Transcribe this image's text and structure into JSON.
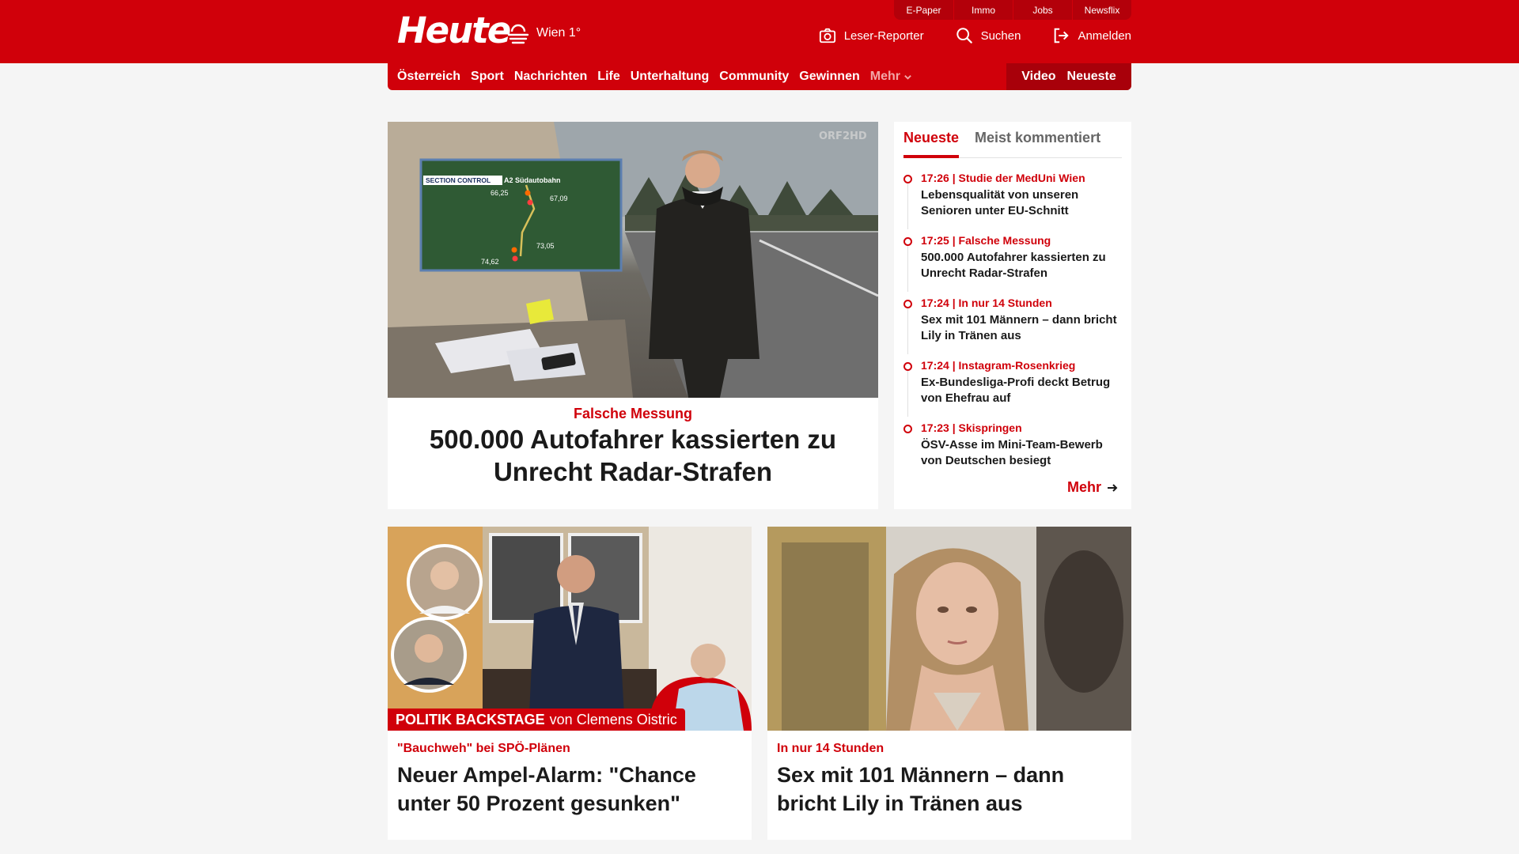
{
  "brand": {
    "logo": "Heute",
    "weather": "Wien 1°"
  },
  "service_tabs": [
    "E-Paper",
    "Immo",
    "Jobs",
    "Newsflix"
  ],
  "header_actions": {
    "reporter": "Leser-Reporter",
    "search": "Suchen",
    "login": "Anmelden"
  },
  "nav": {
    "items": [
      "Österreich",
      "Sport",
      "Nachrichten",
      "Life",
      "Unterhaltung",
      "Community",
      "Gewinnen"
    ],
    "more": "Mehr",
    "right": [
      "Video",
      "Neueste"
    ]
  },
  "hero": {
    "kicker": "Falsche Messung",
    "title": "500.000 Autofahrer kassierten zu Unrecht Radar-Strafen",
    "overlay": {
      "watermark": "ORF2HD",
      "section_label": "SECTION CONTROL",
      "road": "A2 Südautobahn",
      "km1": "66,25",
      "km2": "67,09",
      "km3": "73,05",
      "km4": "74,62"
    }
  },
  "sidebar": {
    "tabs": [
      "Neueste",
      "Meist kommentiert"
    ],
    "items": [
      {
        "time": "17:26",
        "topic": "Studie der MedUni Wien",
        "headline": "Lebensqualität von unseren Senioren unter EU-Schnitt"
      },
      {
        "time": "17:25",
        "topic": "Falsche Messung",
        "headline": "500.000 Autofahrer kassierten zu Unrecht Radar-Strafen"
      },
      {
        "time": "17:24",
        "topic": "In nur 14 Stunden",
        "headline": "Sex mit 101 Männern – dann bricht Lily in Tränen aus"
      },
      {
        "time": "17:24",
        "topic": "Instagram-Rosenkrieg",
        "headline": "Ex-Bundesliga-Profi deckt Betrug von Ehefrau auf"
      },
      {
        "time": "17:23",
        "topic": "Skispringen",
        "headline": "ÖSV-Asse im Mini-Team-Bewerb von Deutschen besiegt"
      }
    ],
    "more": "Mehr"
  },
  "cards": [
    {
      "label_bold": "POLITIK BACKSTAGE",
      "label_rest": "von Clemens Oistric",
      "kicker": "\"Bauchweh\" bei SPÖ-Plänen",
      "title": "Neuer Ampel-Alarm: \"Chance unter 50 Prozent gesunken\""
    },
    {
      "kicker": "In nur 14 Stunden",
      "title": "Sex mit 101 Männern – dann bricht Lily in Tränen aus"
    }
  ],
  "colors": {
    "brand_red": "#d0000a",
    "dark_red": "#a8000a",
    "background": "#f5f5f5"
  }
}
